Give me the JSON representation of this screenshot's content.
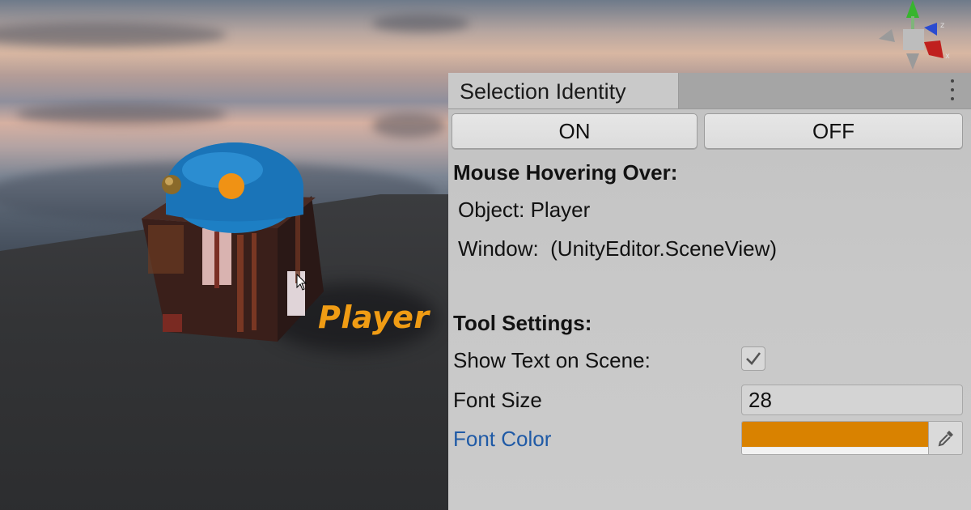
{
  "scene": {
    "object_label": "Player",
    "object_label_color": "#f09c14",
    "gizmo_axes": [
      "y",
      "x",
      "z"
    ]
  },
  "panel": {
    "tab_title": "Selection Identity",
    "menu_icon": "kebab-menu-icon",
    "buttons": {
      "on": "ON",
      "off": "OFF"
    },
    "hover_section": {
      "heading": "Mouse Hovering Over:",
      "object_line": "Object: Player",
      "window_line": "Window:  (UnityEditor.SceneView)"
    },
    "tool_settings": {
      "heading": "Tool Settings:",
      "show_text_label": "Show Text on Scene:",
      "show_text_checked": true,
      "font_size_label": "Font Size",
      "font_size_value": "28",
      "font_color_label": "Font Color",
      "font_color_value": "#d98200",
      "picker_icon": "eyedropper-icon"
    }
  }
}
